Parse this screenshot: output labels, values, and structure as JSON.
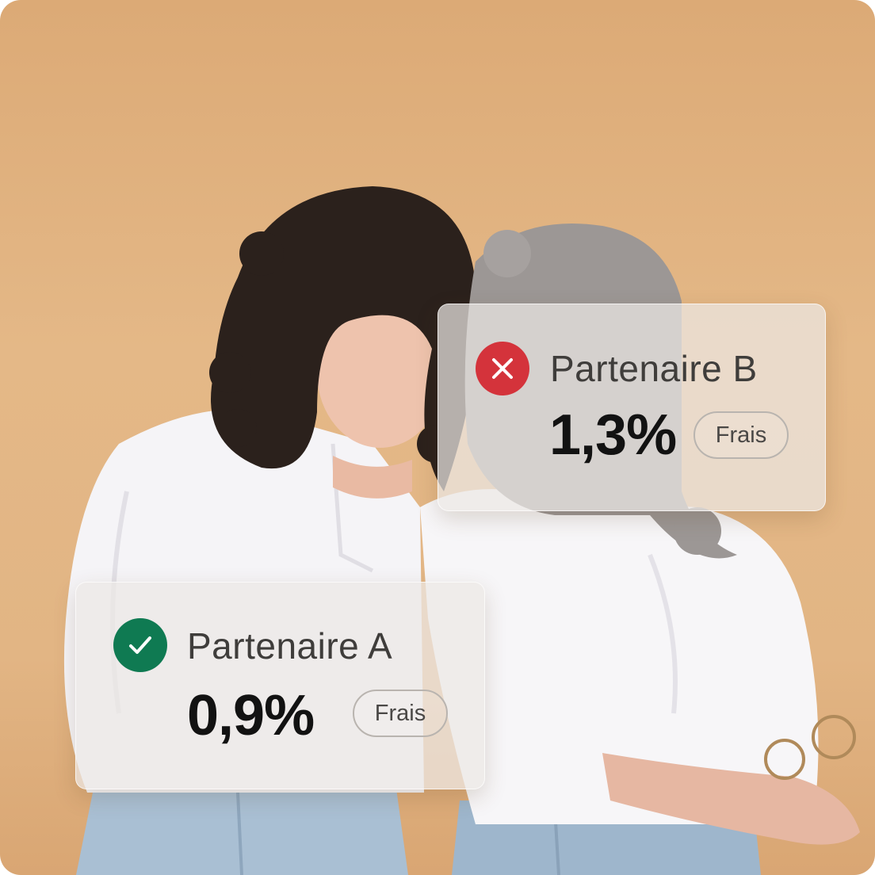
{
  "colors": {
    "background": "#e2b584",
    "success": "#0f7a52",
    "error": "#d4333b",
    "card": "#ece8e4"
  },
  "partners": [
    {
      "name": "Partenaire B",
      "rate": "1,3%",
      "fee_label": "Frais",
      "status": "rejected",
      "icon": "close-icon"
    },
    {
      "name": "Partenaire A",
      "rate": "0,9%",
      "fee_label": "Frais",
      "status": "approved",
      "icon": "check-icon"
    }
  ]
}
